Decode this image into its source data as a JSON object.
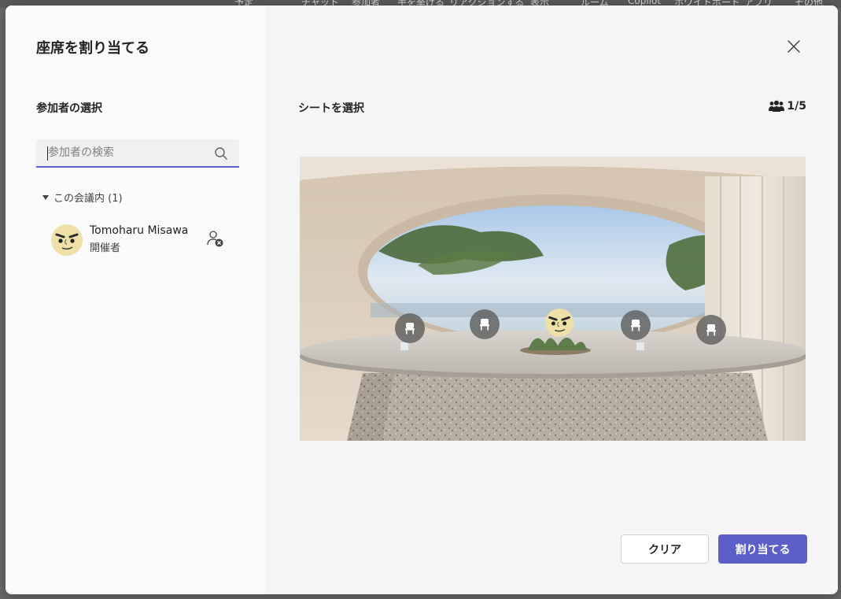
{
  "background_menu": [
    "予定",
    "チャット",
    "参加者",
    "手を挙げる",
    "リアクションする",
    "表示",
    "ルーム",
    "Copilot",
    "ホワイトボード",
    "アプリ",
    "その他"
  ],
  "dialog": {
    "title": "座席を割り当てる",
    "participants_label": "参加者の選択",
    "search_placeholder": "参加者の検索",
    "group_label": "この会議内 (1)",
    "participant": {
      "name": "Tomoharu Misawa",
      "role": "開催者"
    },
    "seat_label": "シートを選択",
    "seat_count": "1/5",
    "buttons": {
      "clear": "クリア",
      "assign": "割り当てる"
    }
  },
  "seats": [
    {
      "state": "empty",
      "icon": "chair-icon"
    },
    {
      "state": "empty",
      "icon": "chair-icon"
    },
    {
      "state": "assigned",
      "icon": "avatar"
    },
    {
      "state": "empty",
      "icon": "chair-icon"
    },
    {
      "state": "empty",
      "icon": "chair-icon"
    }
  ],
  "colors": {
    "accent": "#5b5fc7",
    "panel_left": "#fafafa",
    "panel_right": "#f5f5f5"
  }
}
